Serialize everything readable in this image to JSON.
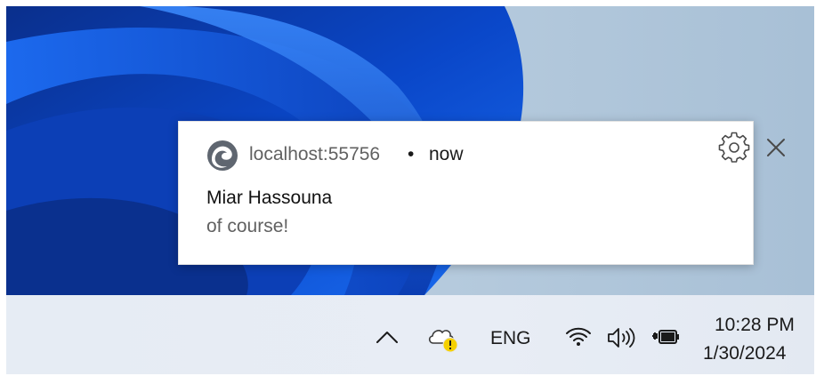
{
  "toast": {
    "source": "localhost:55756",
    "separator": "•",
    "time": "now",
    "sender": "Miar Hassouna",
    "message": "of course!",
    "icons": {
      "app": "edge-browser-icon",
      "settings": "gear-icon",
      "close": "close-icon"
    }
  },
  "taskbar": {
    "language": "ENG",
    "clock_time": "10:28 PM",
    "clock_date": "1/30/2024",
    "icons": [
      "chevron-up-icon",
      "onedrive-cloud-warning-icon",
      "wifi-icon",
      "speaker-icon",
      "battery-charging-icon"
    ]
  },
  "colors": {
    "accent_blue": "#0b4fd6",
    "warning_yellow": "#f5d000"
  }
}
